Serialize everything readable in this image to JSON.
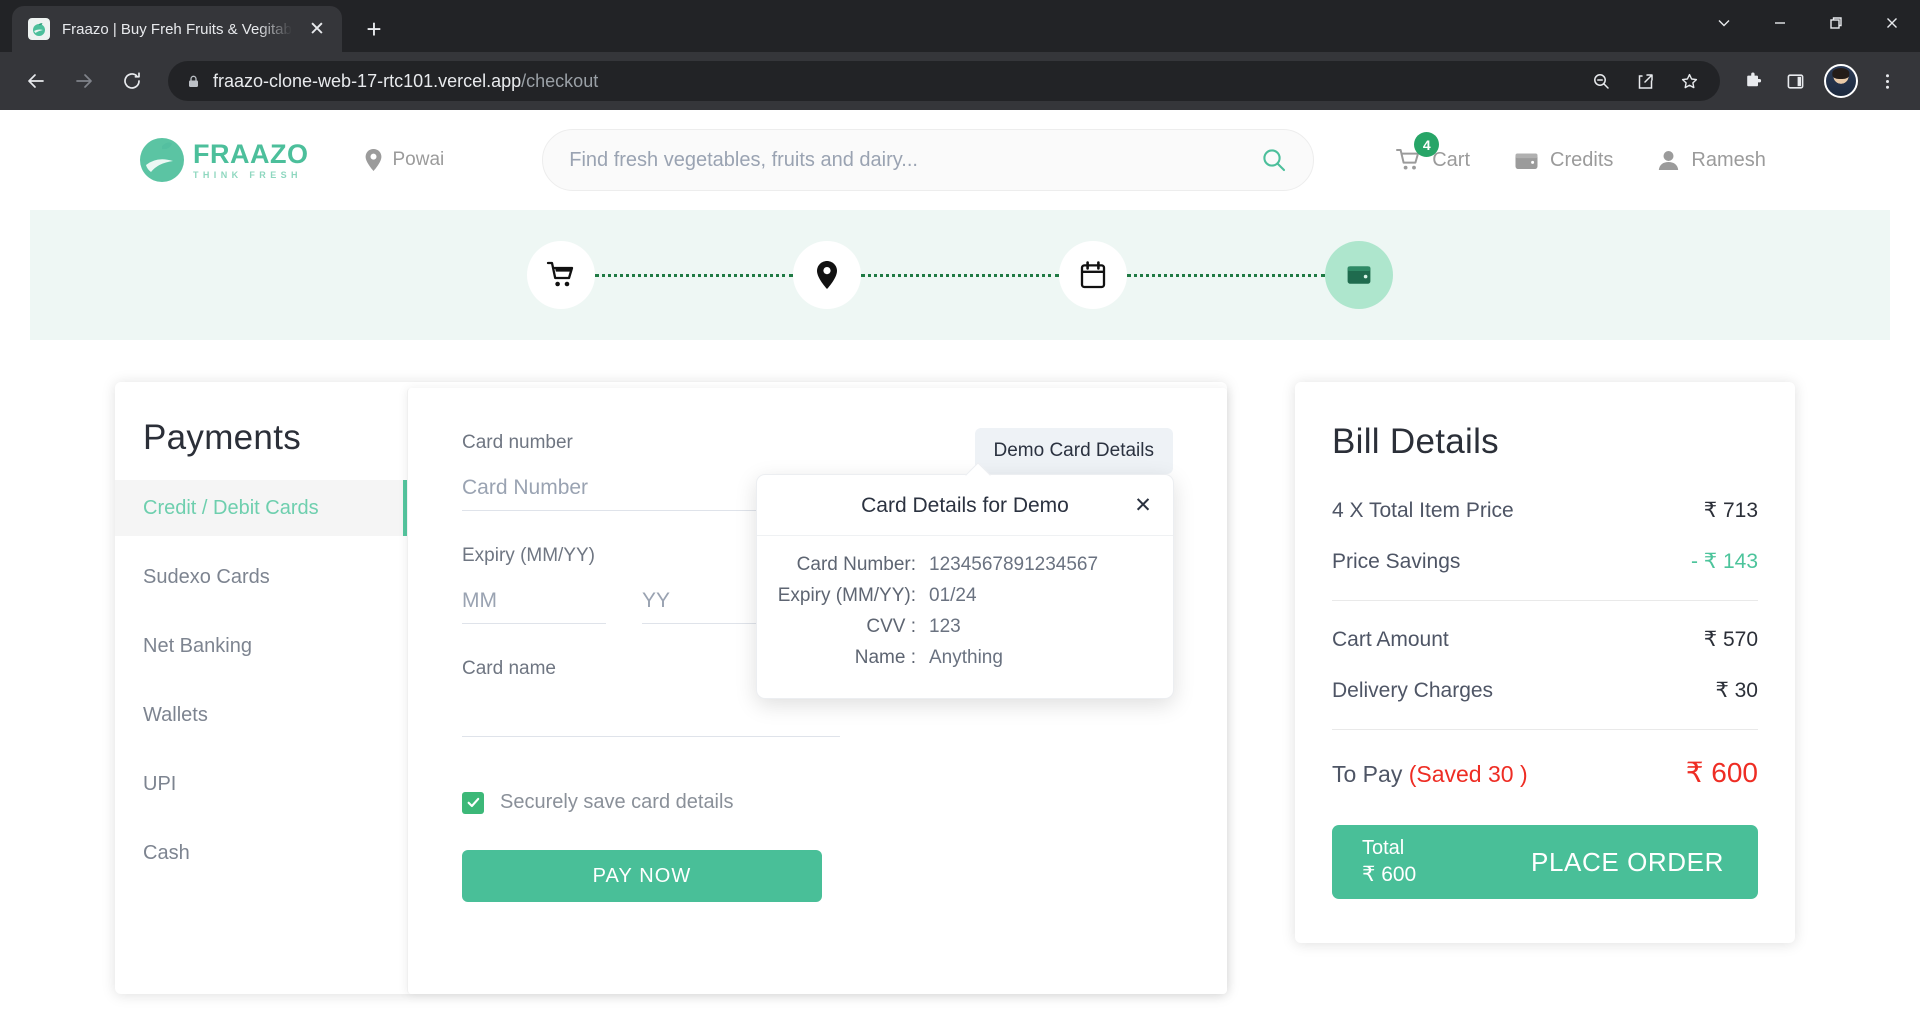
{
  "browser": {
    "tab_title": "Fraazo | Buy Freh Fruits & Vegitables",
    "new_tab_label": "+",
    "close_tab_label": "✕",
    "url_host": "fraazo-clone-web-17-rtc101.vercel.app",
    "url_path": "/checkout"
  },
  "header": {
    "logo_name": "FRAAZO",
    "logo_tagline": "THINK FRESH",
    "location": "Powai",
    "search_placeholder": "Find fresh vegetables, fruits and dairy...",
    "search_value": "",
    "cart_label": "Cart",
    "cart_count": "4",
    "credits_label": "Credits",
    "user_label": "Ramesh"
  },
  "stepper": {
    "steps": [
      {
        "name": "cart",
        "active": false
      },
      {
        "name": "address",
        "active": false
      },
      {
        "name": "slot",
        "active": false
      },
      {
        "name": "payment",
        "active": true
      }
    ]
  },
  "payments": {
    "title": "Payments",
    "methods": [
      {
        "label": "Credit / Debit Cards",
        "active": true
      },
      {
        "label": "Sudexo Cards",
        "active": false
      },
      {
        "label": "Net Banking",
        "active": false
      },
      {
        "label": "Wallets",
        "active": false
      },
      {
        "label": "UPI",
        "active": false
      },
      {
        "label": "Cash",
        "active": false
      }
    ],
    "form": {
      "card_number_label": "Card number",
      "card_number_placeholder": "Card Number",
      "card_number_value": "",
      "expiry_label": "Expiry (MM/YY)",
      "expiry_mm_placeholder": "MM",
      "expiry_mm_value": "",
      "expiry_yy_placeholder": "YY",
      "expiry_yy_value": "",
      "card_name_label": "Card name",
      "card_name_placeholder": "",
      "card_name_value": "",
      "save_card_label": "Securely save card details",
      "save_card_checked": true,
      "pay_now_label": "PAY NOW"
    },
    "demo_button_label": "Demo Card Details",
    "demo_popover": {
      "title": "Card Details for Demo",
      "close_label": "✕",
      "rows": [
        {
          "label": "Card Number:",
          "value": "1234567891234567"
        },
        {
          "label": "Expiry (MM/YY):",
          "value": "01/24"
        },
        {
          "label": "CVV :",
          "value": "123"
        },
        {
          "label": "Name :",
          "value": "Anything"
        }
      ]
    }
  },
  "bill": {
    "title": "Bill Details",
    "item_price_label": "4 X Total Item Price",
    "item_price_value": "₹ 713",
    "savings_label": "Price Savings",
    "savings_value": "- ₹ 143",
    "cart_amount_label": "Cart Amount",
    "cart_amount_value": "₹ 570",
    "delivery_label": "Delivery Charges",
    "delivery_value": "₹ 30",
    "to_pay_label": "To Pay ",
    "to_pay_saved": "(Saved 30 )",
    "to_pay_value": "₹ 600",
    "total_label": "Total",
    "total_value": "₹ 600",
    "place_order_label": "PLACE ORDER"
  },
  "colors": {
    "brand_green": "#49bf98",
    "accent_green": "#4cc49b",
    "badge_green": "#27a567",
    "alert_red": "#ee2d24",
    "band_mint": "#eef7f4"
  }
}
